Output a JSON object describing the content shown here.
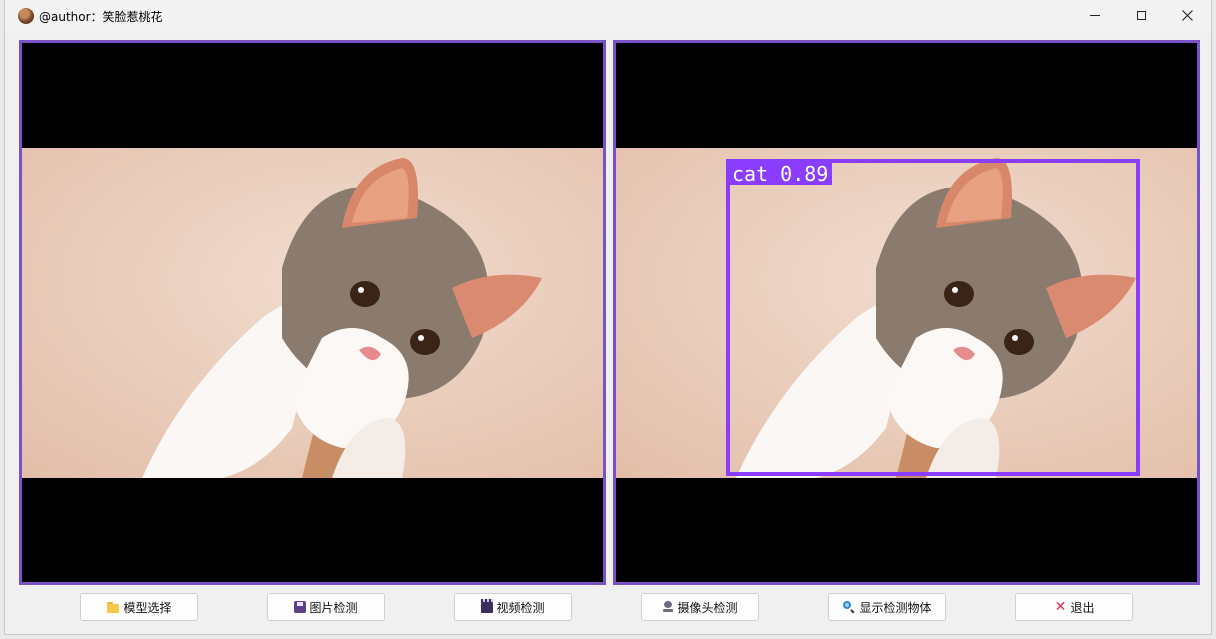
{
  "window": {
    "title": "@author：笑脸惹桃花",
    "icon": "app-avatar-icon",
    "controls": [
      "minimize-icon",
      "maximize-icon",
      "close-icon"
    ]
  },
  "panels": {
    "left": {
      "content": "original cat image"
    },
    "right": {
      "content": "detected cat image",
      "detection": {
        "label": "cat 0.89",
        "color": "#8a3cff"
      }
    },
    "border_color": "#7a52c7"
  },
  "buttons": [
    {
      "label": "模型选择",
      "icon": "folder-icon"
    },
    {
      "label": "图片检测",
      "icon": "save-disk-icon"
    },
    {
      "label": "视频检测",
      "icon": "clapperboard-icon"
    },
    {
      "label": "摄像头检测",
      "icon": "camera-icon"
    },
    {
      "label": "显示检测物体",
      "icon": "magnifier-icon"
    },
    {
      "label": "退出",
      "icon": "cross-icon"
    }
  ]
}
